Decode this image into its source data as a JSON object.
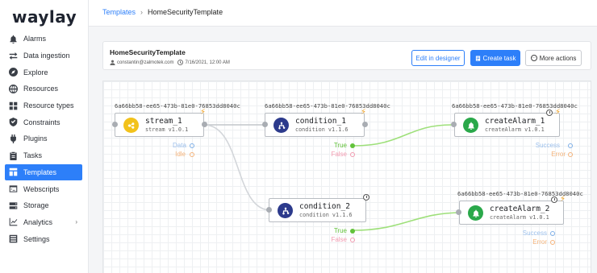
{
  "app": {
    "logo": "waylay"
  },
  "sidebar": {
    "items": [
      {
        "label": "Alarms",
        "icon": "bell-icon"
      },
      {
        "label": "Data ingestion",
        "icon": "arrows-icon"
      },
      {
        "label": "Explore",
        "icon": "compass-icon"
      },
      {
        "label": "Resources",
        "icon": "globe-icon"
      },
      {
        "label": "Resource types",
        "icon": "grid-icon"
      },
      {
        "label": "Constraints",
        "icon": "shield-icon"
      },
      {
        "label": "Plugins",
        "icon": "plug-icon"
      },
      {
        "label": "Tasks",
        "icon": "clipboard-icon"
      },
      {
        "label": "Templates",
        "icon": "template-icon",
        "active": true
      },
      {
        "label": "Webscripts",
        "icon": "code-icon"
      },
      {
        "label": "Storage",
        "icon": "storage-icon"
      },
      {
        "label": "Analytics",
        "icon": "chart-icon",
        "expandable": true
      },
      {
        "label": "Settings",
        "icon": "settings-icon"
      }
    ]
  },
  "breadcrumb": {
    "parent": "Templates",
    "current": "HomeSecurityTemplate"
  },
  "template": {
    "name": "HomeSecurityTemplate",
    "owner": "constantin@zalmotek.com",
    "date": "7/16/2021, 12:00 AM"
  },
  "actions": {
    "edit": "Edit in designer",
    "create": "Create task",
    "more": "More actions"
  },
  "nodes": {
    "stream_1": {
      "id": "6a66bb58-ee65-473b-81e0-76853dd8040c",
      "name": "stream_1",
      "sub": "stream v1.0.1",
      "out1": "Data",
      "out2": "Idle"
    },
    "condition_1": {
      "id": "6a66bb58-ee65-473b-81e0-76853dd8040c",
      "name": "condition_1",
      "sub": "condition v1.1.6",
      "out1": "True",
      "out2": "False"
    },
    "createAlarm_1": {
      "id": "6a66bb58-ee65-473b-81e0-76853dd8040c",
      "name": "createAlarm_1",
      "sub": "createAlarm v1.0.1",
      "out1": "Success",
      "out2": "Error"
    },
    "condition_2": {
      "name": "condition_2",
      "sub": "condition v1.1.6",
      "out1": "True",
      "out2": "False"
    },
    "createAlarm_2": {
      "id": "6a66bb58-ee65-473b-81e0-76853dd8040c",
      "name": "createAlarm_2",
      "sub": "createAlarm v1.0.1",
      "out1": "Success",
      "out2": "Error"
    }
  },
  "colors": {
    "accent": "#2d7ff9",
    "stream": "#f2c21b",
    "condition": "#2c3a8c",
    "alarm": "#2aa84a",
    "true": "#62c23a",
    "false": "#f29bb0",
    "success": "#7fb0e8",
    "error": "#f5b37a",
    "bolt": "#f0a020"
  }
}
